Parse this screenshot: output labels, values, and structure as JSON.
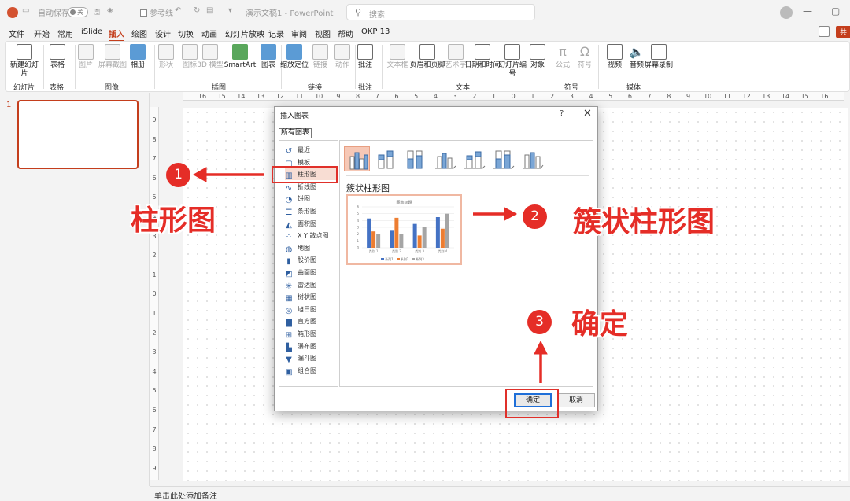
{
  "titlebar": {
    "autosave_label": "自动保存",
    "autosave_state": "关",
    "grid_label": "参考线",
    "doc_title": "演示文稿1 - PowerPoint",
    "search_placeholder": "搜索"
  },
  "menu": {
    "items": [
      "文件",
      "开始",
      "常用",
      "iSlide",
      "插入",
      "绘图",
      "设计",
      "切换",
      "动画",
      "幻灯片放映",
      "记录",
      "审阅",
      "视图",
      "帮助",
      "OKP 13"
    ],
    "active": "插入",
    "share_label": "共"
  },
  "ribbon": {
    "buttons": {
      "new_slide": "新建幻灯片",
      "table": "表格",
      "picture": "图片",
      "screenshot": "屏幕截图",
      "album": "相册",
      "shapes": "形状",
      "icons": "图标",
      "model3d": "3D 模型",
      "smartart": "SmartArt",
      "chart": "图表",
      "zoom": "缩放定位",
      "link": "链接",
      "action": "动作",
      "comment": "批注",
      "textbox": "文本框",
      "header_footer": "页眉和页脚",
      "wordart": "艺术字",
      "datetime": "日期和时间",
      "slide_number": "幻灯片编号",
      "object": "对象",
      "equation": "公式",
      "symbol": "符号",
      "video": "视频",
      "audio": "音频",
      "screen_record": "屏幕录制"
    },
    "groups": {
      "slides": "幻灯片",
      "tables": "表格",
      "images": "图像",
      "illustrations": "插图",
      "links": "链接",
      "comments": "批注",
      "text": "文本",
      "symbols": "符号",
      "media": "媒体"
    }
  },
  "slide_panel": {
    "slide_number": "1"
  },
  "ruler": {
    "horizontal": [
      "16",
      "15",
      "14",
      "13",
      "12",
      "11",
      "10",
      "9",
      "8",
      "7",
      "6",
      "5",
      "4",
      "3",
      "2",
      "1",
      "0",
      "1",
      "2",
      "3",
      "4",
      "5",
      "6",
      "7",
      "8",
      "9",
      "10",
      "11",
      "12",
      "13",
      "14",
      "15",
      "16"
    ],
    "vertical": [
      "9",
      "8",
      "7",
      "6",
      "5",
      "4",
      "3",
      "2",
      "1",
      "0",
      "1",
      "2",
      "3",
      "4",
      "5",
      "6",
      "7",
      "8",
      "9"
    ]
  },
  "notes_placeholder": "单击此处添加备注",
  "dialog": {
    "title": "插入图表",
    "help": "?",
    "close": "✕",
    "tab": "所有图表",
    "categories": [
      {
        "label": "最近",
        "icon": "recent-icon"
      },
      {
        "label": "模板",
        "icon": "template-icon"
      },
      {
        "label": "柱形图",
        "icon": "column-chart-icon"
      },
      {
        "label": "折线图",
        "icon": "line-chart-icon"
      },
      {
        "label": "饼图",
        "icon": "pie-chart-icon"
      },
      {
        "label": "条形图",
        "icon": "bar-chart-icon"
      },
      {
        "label": "面积图",
        "icon": "area-chart-icon"
      },
      {
        "label": "X Y 散点图",
        "icon": "scatter-chart-icon"
      },
      {
        "label": "地图",
        "icon": "map-chart-icon"
      },
      {
        "label": "股价图",
        "icon": "stock-chart-icon"
      },
      {
        "label": "曲面图",
        "icon": "surface-chart-icon"
      },
      {
        "label": "雷达图",
        "icon": "radar-chart-icon"
      },
      {
        "label": "树状图",
        "icon": "treemap-chart-icon"
      },
      {
        "label": "旭日图",
        "icon": "sunburst-chart-icon"
      },
      {
        "label": "直方图",
        "icon": "histogram-chart-icon"
      },
      {
        "label": "箱形图",
        "icon": "box-chart-icon"
      },
      {
        "label": "瀑布图",
        "icon": "waterfall-chart-icon"
      },
      {
        "label": "漏斗图",
        "icon": "funnel-chart-icon"
      },
      {
        "label": "组合图",
        "icon": "combo-chart-icon"
      }
    ],
    "selected_category": "柱形图",
    "subtype_title": "簇状柱形图",
    "preview": {
      "title": "图表标题",
      "categories": [
        "类别 1",
        "类别 2",
        "类别 3",
        "类别 4"
      ],
      "series": [
        {
          "name": "系列1",
          "values": [
            4.3,
            2.5,
            3.5,
            4.5
          ]
        },
        {
          "name": "系列2",
          "values": [
            2.4,
            4.4,
            1.8,
            2.8
          ]
        },
        {
          "name": "系列3",
          "values": [
            2,
            2,
            3,
            5
          ]
        }
      ],
      "ylim": [
        0,
        6
      ],
      "colors": [
        "#4472c4",
        "#ed7d31",
        "#a5a5a5"
      ]
    },
    "ok_label": "确定",
    "cancel_label": "取消"
  },
  "annotations": {
    "step1_num": "1",
    "step1_text": "柱形图",
    "step2_num": "2",
    "step2_text": "簇状柱形图",
    "step3_num": "3",
    "step3_text": "确定",
    "color": "#e52d27"
  }
}
